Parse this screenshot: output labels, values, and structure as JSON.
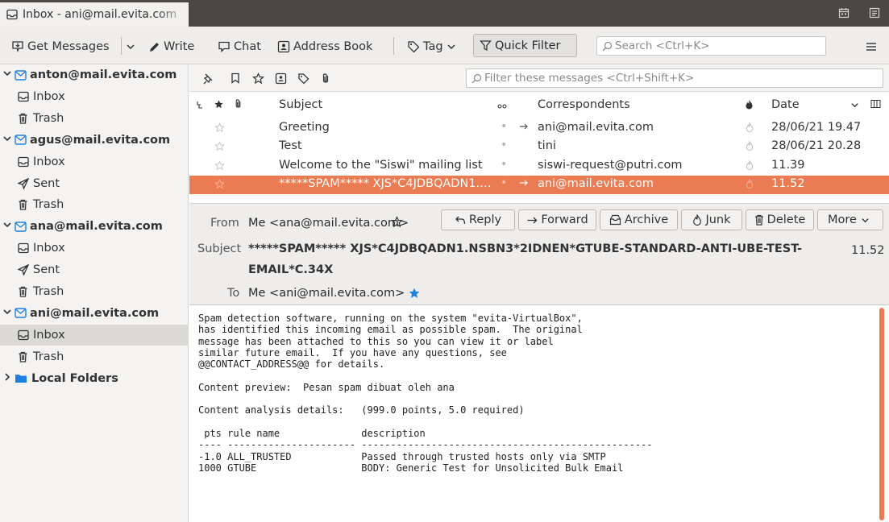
{
  "window": {
    "tab_title": "Inbox - ani@mail.evita.com"
  },
  "toolbar": {
    "get_messages": "Get Messages",
    "write": "Write",
    "chat": "Chat",
    "address_book": "Address Book",
    "tag": "Tag",
    "quick_filter": "Quick Filter",
    "search_placeholder": "Search <Ctrl+K>"
  },
  "folders": [
    {
      "type": "account",
      "label": "anton@mail.evita.com"
    },
    {
      "type": "inbox",
      "label": "Inbox"
    },
    {
      "type": "trash",
      "label": "Trash"
    },
    {
      "type": "account",
      "label": "agus@mail.evita.com"
    },
    {
      "type": "inbox",
      "label": "Inbox"
    },
    {
      "type": "sent",
      "label": "Sent"
    },
    {
      "type": "trash",
      "label": "Trash"
    },
    {
      "type": "account",
      "label": "ana@mail.evita.com"
    },
    {
      "type": "inbox",
      "label": "Inbox"
    },
    {
      "type": "sent",
      "label": "Sent"
    },
    {
      "type": "trash",
      "label": "Trash"
    },
    {
      "type": "account",
      "label": "ani@mail.evita.com"
    },
    {
      "type": "inbox",
      "label": "Inbox",
      "selected": true
    },
    {
      "type": "trash",
      "label": "Trash"
    },
    {
      "type": "local",
      "label": "Local Folders"
    }
  ],
  "quickfilter": {
    "filter_placeholder": "Filter these messages <Ctrl+Shift+K>"
  },
  "columns": {
    "subject": "Subject",
    "correspondents": "Correspondents",
    "date": "Date"
  },
  "messages": [
    {
      "subject": "Greeting",
      "correspondent": "ani@mail.evita.com",
      "date": "28/06/21 19.47",
      "arrow": true
    },
    {
      "subject": "Test",
      "correspondent": "tini",
      "date": "28/06/21 20.28",
      "arrow": false
    },
    {
      "subject": "Welcome to the \"Siswi\" mailing list",
      "correspondent": "siswi-request@putri.com",
      "date": "11.39",
      "arrow": false
    },
    {
      "subject": "*****SPAM***** XJS*C4JDBQADN1.NSBN3*2IDNEN*GTUBE",
      "correspondent": "ani@mail.evita.com",
      "date": "11.52",
      "arrow": true,
      "selected": true
    }
  ],
  "header": {
    "from_label": "From",
    "from_value": "Me <ana@mail.evita.com>",
    "subject_label": "Subject",
    "subject_line1": "*****SPAM***** XJS*C4JDBQADN1.NSBN3*2IDNEN*GTUBE-STANDARD-ANTI-UBE-TEST-",
    "subject_line2": "EMAIL*C.34X",
    "time": "11.52",
    "to_label": "To",
    "to_value": "Me <ani@mail.evita.com>",
    "buttons": {
      "reply": "Reply",
      "forward": "Forward",
      "archive": "Archive",
      "junk": "Junk",
      "delete": "Delete",
      "more": "More"
    }
  },
  "body_text": "Spam detection software, running on the system \"evita-VirtualBox\",\nhas identified this incoming email as possible spam.  The original\nmessage has been attached to this so you can view it or label\nsimilar future email.  If you have any questions, see\n@@CONTACT_ADDRESS@@ for details.\n\nContent preview:  Pesan spam dibuat oleh ana\n\nContent analysis details:   (999.0 points, 5.0 required)\n\n pts rule name              description\n---- ---------------------- --------------------------------------------------\n-1.0 ALL_TRUSTED            Passed through trusted hosts only via SMTP\n1000 GTUBE                  BODY: Generic Test for Unsolicited Bulk Email",
  "colors": {
    "accent": "#eb7b52",
    "titlebar": "#4a4845",
    "star_blue": "#1d7fe0"
  }
}
